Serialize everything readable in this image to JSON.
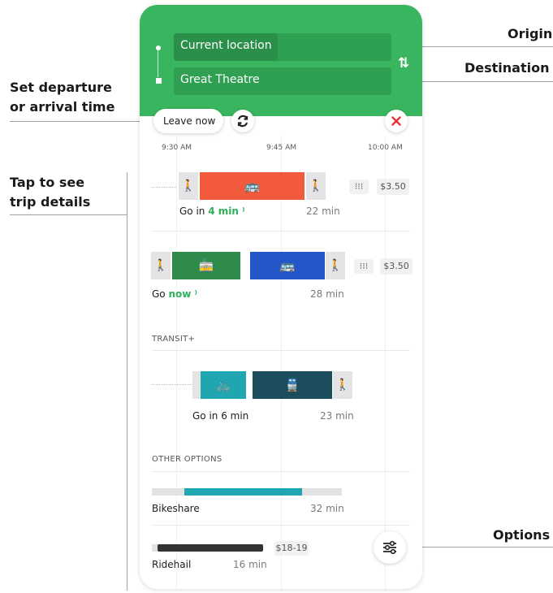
{
  "callouts": {
    "origin": "Origin",
    "destination": "Destination",
    "departure_line1": "Set departure",
    "departure_line2": "or arrival time",
    "trip_line1": "Tap to see",
    "trip_line2": "trip details",
    "options": "Options"
  },
  "search": {
    "origin": "Current location",
    "destination": "Great Theatre",
    "swap_icon": "swap-vertical-icon"
  },
  "controls": {
    "leave_label": "Leave now",
    "refresh_icon": "refresh-icon",
    "close_icon": "close-icon"
  },
  "timeline": {
    "ticks": [
      "9:30 AM",
      "9:45 AM",
      "10:00 AM"
    ]
  },
  "trips": [
    {
      "go_prefix": "Go in ",
      "go_highlight": "4 min",
      "duration": "22 min",
      "price": "$3.50",
      "segment_color": "#f15a3c",
      "icons": [
        "walk-icon",
        "bus-icon",
        "walk-icon"
      ]
    },
    {
      "go_prefix": "Go ",
      "go_highlight": "now",
      "duration": "28 min",
      "price": "$3.50",
      "segment_colors": [
        "#2e8b4a",
        "#2356c7"
      ],
      "icons": [
        "walk-icon",
        "tram-icon",
        "bus-icon",
        "walk-icon"
      ]
    }
  ],
  "transit_plus": {
    "heading": "TRANSIT+",
    "go_label": "Go in 6 min",
    "duration": "23 min",
    "segment_colors": [
      "#1fa6b0",
      "#1b4d5c"
    ],
    "icons": [
      "bike-icon",
      "train-icon",
      "walk-icon"
    ]
  },
  "other_options": {
    "heading": "OTHER OPTIONS",
    "bikeshare": {
      "label": "Bikeshare",
      "duration": "32 min",
      "color": "#1fa6b0"
    },
    "ridehail": {
      "label": "Ridehail",
      "duration": "16 min",
      "price": "$18-19",
      "color": "#333333"
    }
  },
  "options_button": {
    "icon": "sliders-icon"
  },
  "colors": {
    "header": "#38b55e",
    "accent_green": "#2fb05a",
    "close_red": "#e5313a"
  }
}
